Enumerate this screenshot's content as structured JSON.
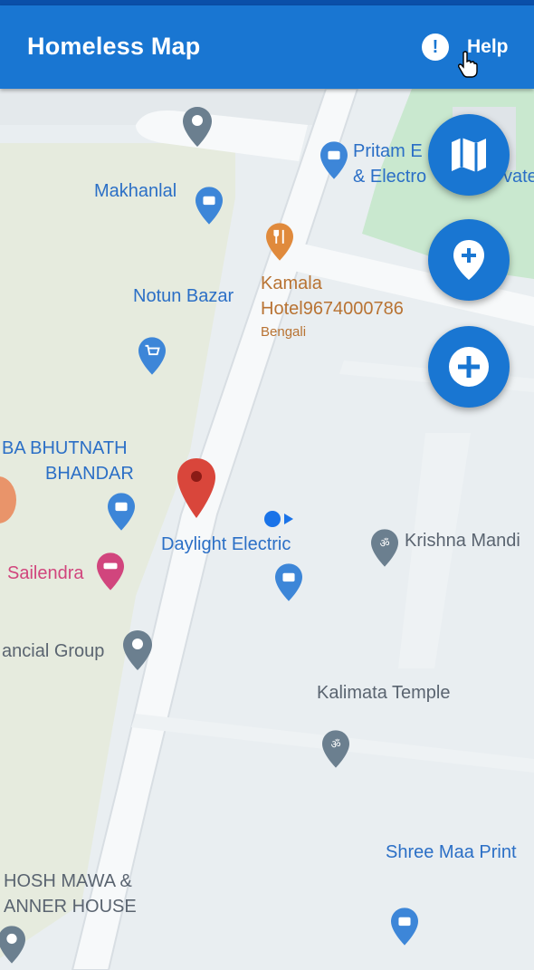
{
  "app": {
    "title": "Homeless Map",
    "help_label": "Help"
  },
  "map_labels": {
    "pritam": "Pritam E",
    "electro": "& Electro",
    "vate": "vate",
    "makhanlal": "Makhanlal",
    "notun_bazar": "Notun Bazar",
    "kamala": "Kamala",
    "hotel": "Hotel9674000786",
    "bengali": "Bengali",
    "bhutnath1": "BA BHUTNATH",
    "bhutnath2": "BHANDAR",
    "daylight": "Daylight Electric",
    "krishna": "Krishna Mandi",
    "sailendra": "Sailendra",
    "financial": "ancial Group",
    "kalimata": "Kalimata Temple",
    "shree_maa": "Shree Maa Print",
    "ghosh1": "HOSH MAWA &",
    "ghosh2": "ANNER HOUSE"
  },
  "icons": {
    "map_fab": "map-icon",
    "add_location_fab": "add-location-icon",
    "add_fab": "add-icon",
    "help": "info-icon"
  },
  "colors": {
    "appbar": "#1976d2",
    "fab": "#1976d2",
    "marker": "#d9463b",
    "park": "#c9e8cf",
    "block": "#e6ebde"
  }
}
